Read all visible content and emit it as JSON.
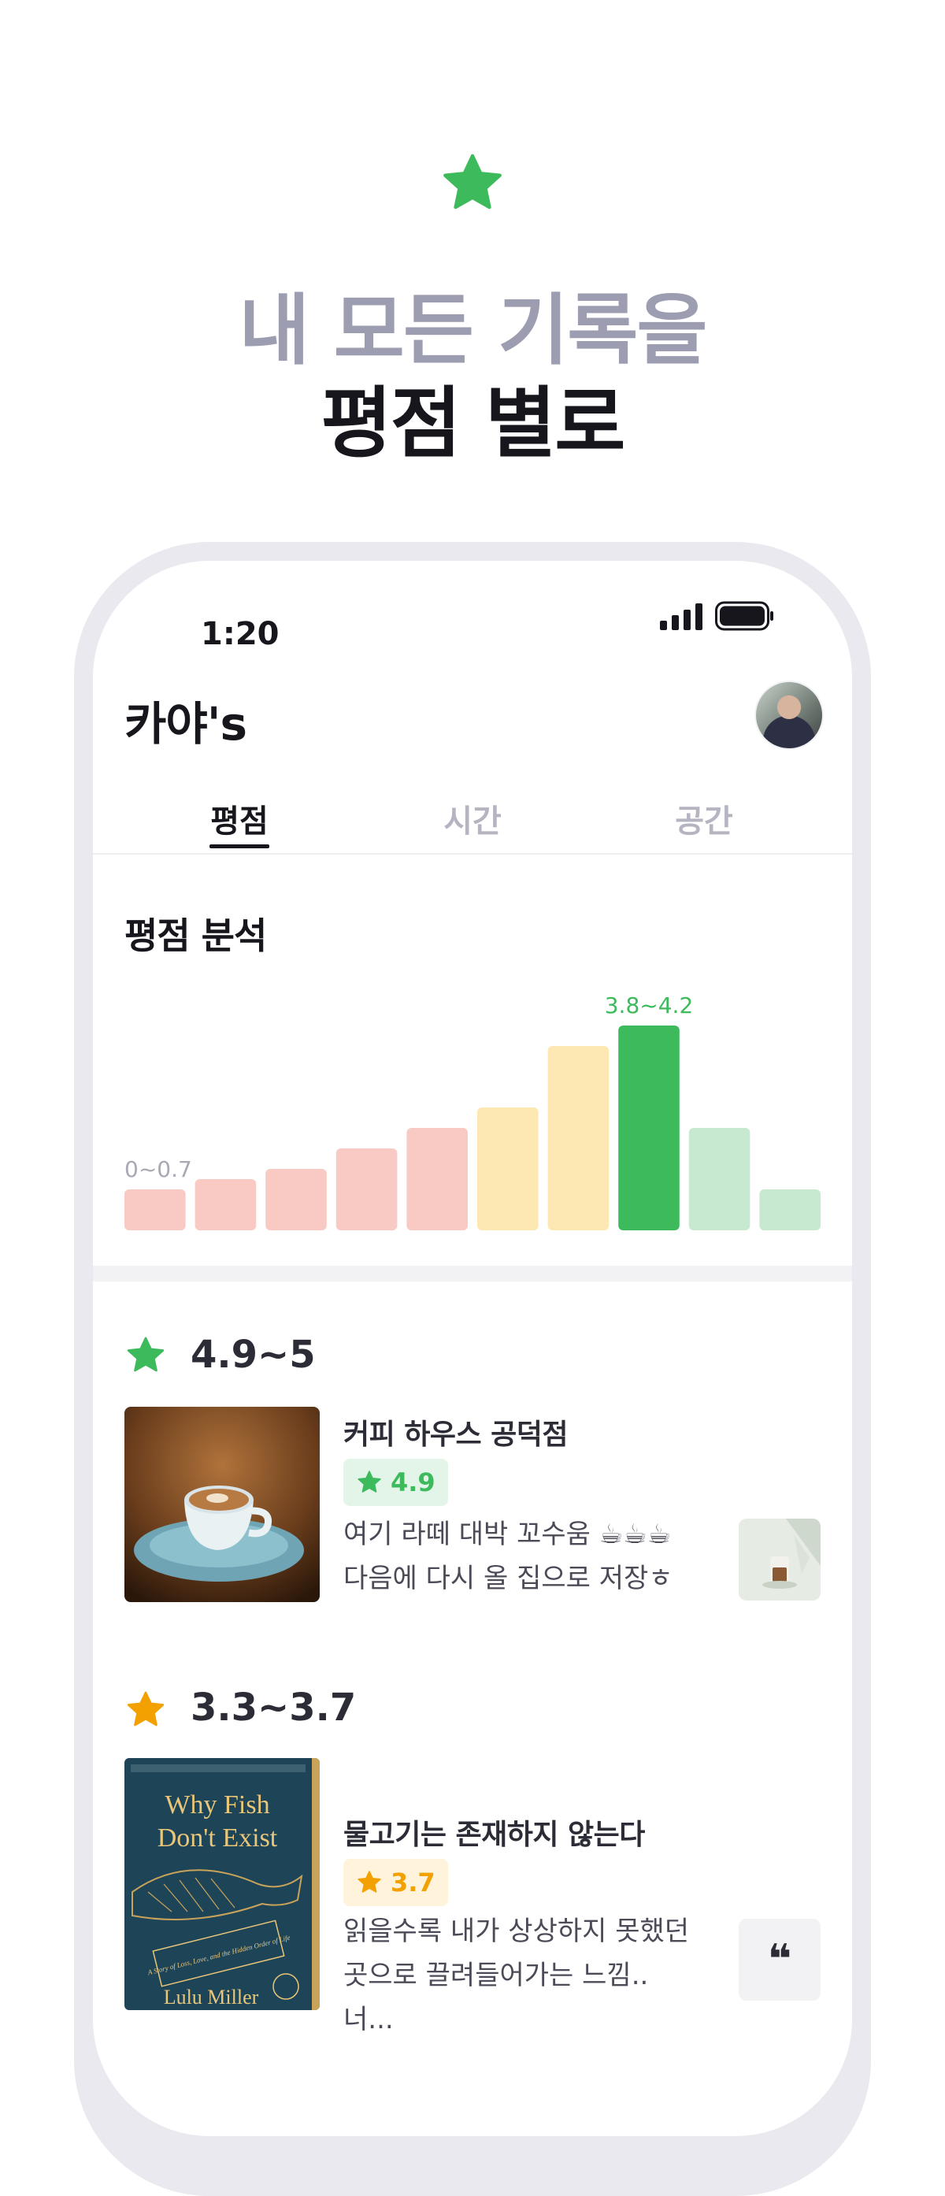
{
  "hero": {
    "line1": "내 모든 기록을",
    "line2": "평점 별로"
  },
  "status_bar": {
    "time": "1:20"
  },
  "header": {
    "title": "카야's"
  },
  "tabs": [
    {
      "label": "평점",
      "active": true
    },
    {
      "label": "시간",
      "active": false
    },
    {
      "label": "공간",
      "active": false
    }
  ],
  "analysis": {
    "title": "평점 분석"
  },
  "chart_data": {
    "type": "bar",
    "categories": [
      "0~0.7",
      "",
      "",
      "",
      "",
      "",
      "",
      "3.8~4.2",
      "",
      ""
    ],
    "values": [
      2,
      2.5,
      3,
      4,
      5,
      6,
      9,
      10,
      5,
      2
    ],
    "colors": [
      "#f9cac4",
      "#f9cac4",
      "#f9cac4",
      "#f9cac4",
      "#f9cac4",
      "#fde8b3",
      "#fde8b3",
      "#3dbb5c",
      "#c7e9cf",
      "#c7e9cf"
    ],
    "visible_labels": [
      "0~0.7",
      "3.8~4.2"
    ]
  },
  "groups": [
    {
      "range": "4.9~5",
      "star_color": "#3dbb5c",
      "item": {
        "name": "커피 하우스 공덕점",
        "rating": "4.9",
        "review_line1": "여기 라떼 대박 꼬수움 ☕☕☕",
        "review_line2": "다음에 다시 올 집으로 저장ㅎ"
      }
    },
    {
      "range": "3.3~3.7",
      "star_color": "#f2a100",
      "item": {
        "name": "물고기는 존재하지 않는다",
        "rating": "3.7",
        "review_line1": "읽을수록 내가 상상하지 못했던",
        "review_line2": "곳으로 끌려들어가는 느낌.. 너...",
        "book_cover": {
          "title_line1": "Why Fish",
          "title_line2": "Don't Exist",
          "subtitle": "A Story of Loss, Love, and the Hidden Order of Life",
          "author": "Lulu Miller"
        },
        "quote_icon": "❝"
      }
    }
  ]
}
